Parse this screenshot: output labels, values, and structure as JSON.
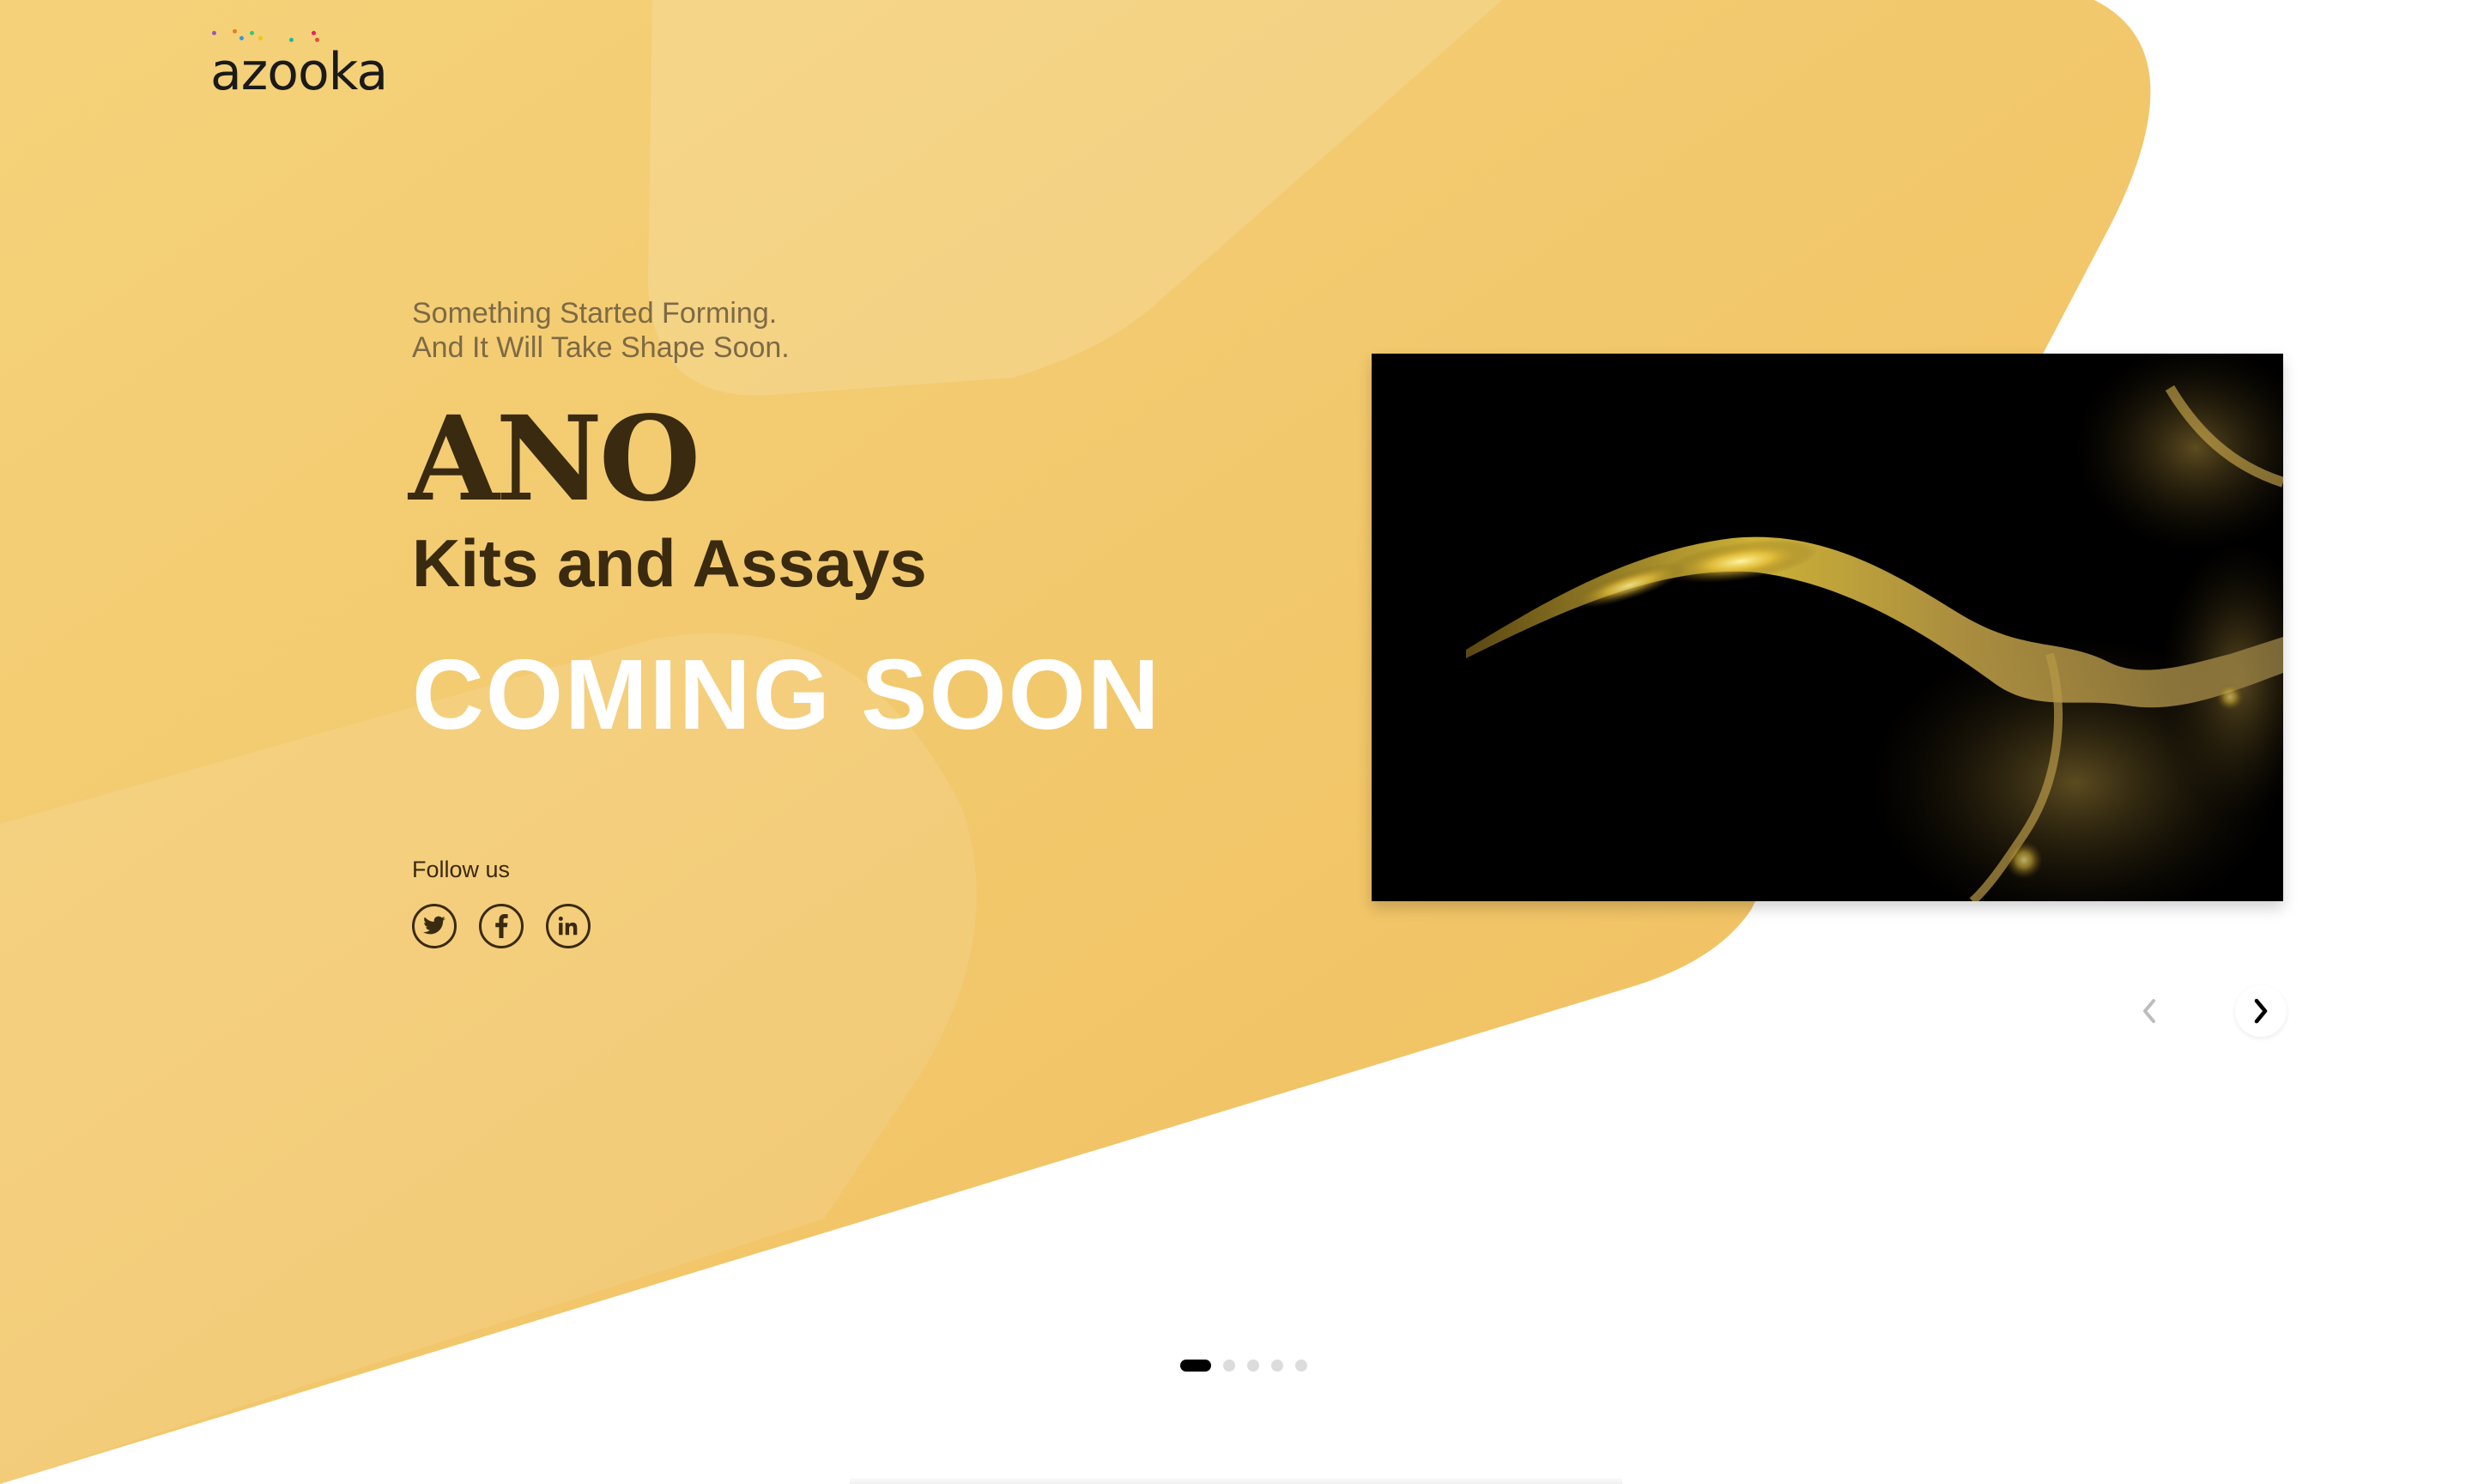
{
  "brand": {
    "logo_text": "azooka",
    "dot_colors": [
      "#9b59b6",
      "#e67e22",
      "#2ecc71",
      "#3498db",
      "#f1c40f",
      "#e74c3c",
      "#1abc9c",
      "#e91e63"
    ]
  },
  "hero": {
    "tagline_line1": "Something Started Forming.",
    "tagline_line2": "And It Will Take Shape Soon.",
    "product_name": "ANO",
    "subtitle": "Kits and Assays",
    "status": "COMING SOON"
  },
  "social": {
    "follow_label": "Follow us",
    "icons": [
      "twitter-icon",
      "facebook-icon",
      "linkedin-icon"
    ]
  },
  "slider": {
    "total_slides": 5,
    "active_slide": 1,
    "image_subject": "glowing golden nematode worm on black background"
  },
  "colors": {
    "hero_yellow": "#f3c96a",
    "text_dark": "#3a2a10",
    "tagline": "#7d6a45",
    "accent_white": "#ffffff"
  }
}
